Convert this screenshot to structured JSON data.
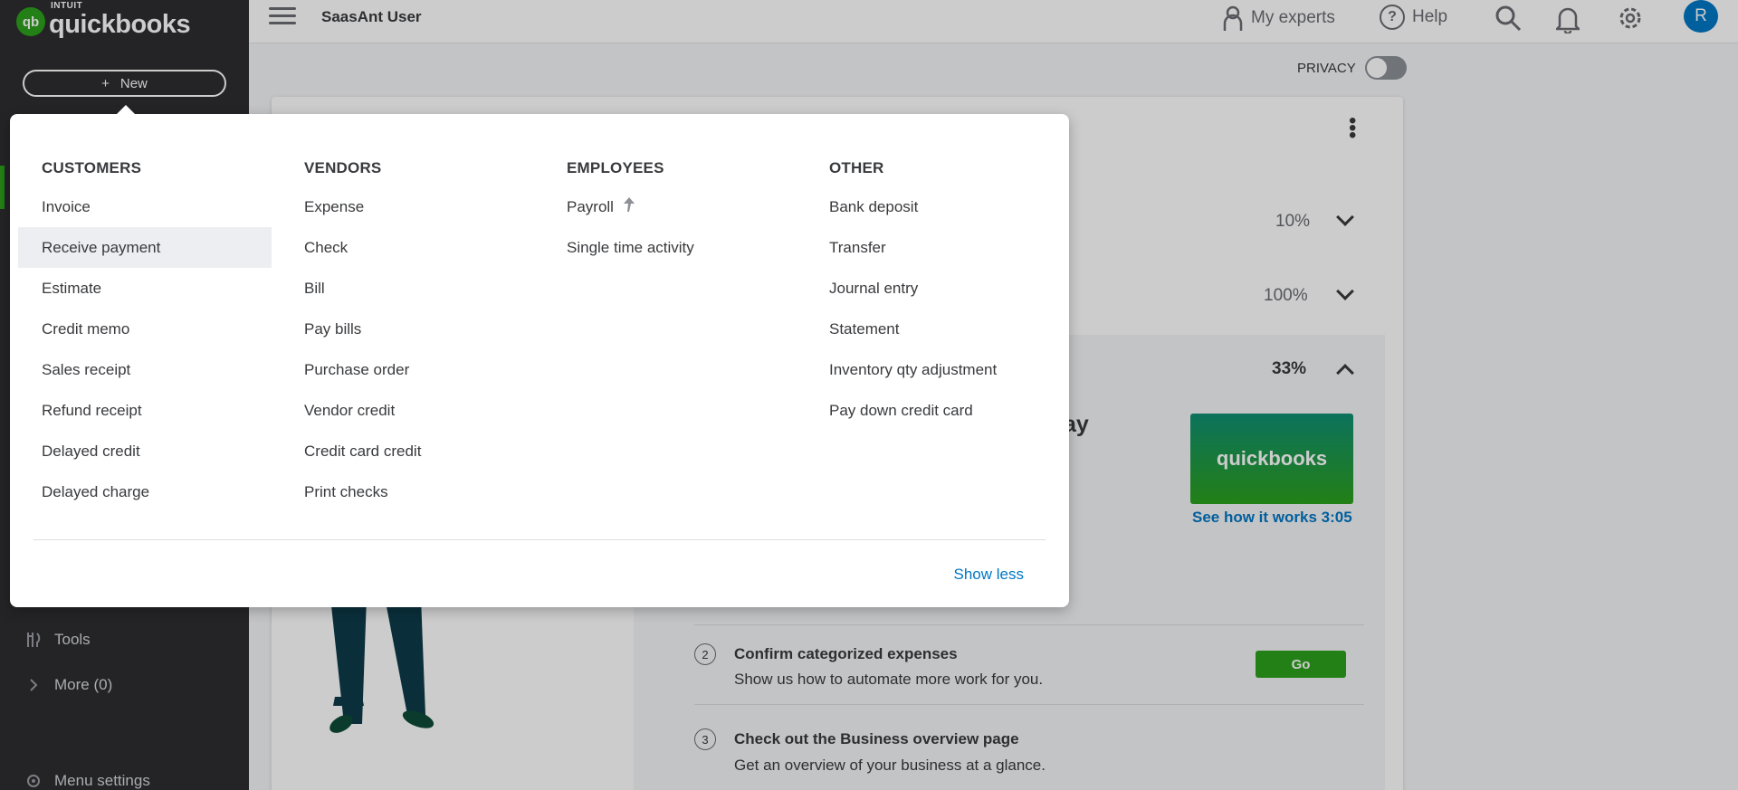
{
  "app": {
    "logo_brand": "INTUIT",
    "logo_word": "quickbooks",
    "company_name": "SaasAnt User"
  },
  "sidebar": {
    "new_button_label": "New",
    "items": [
      {
        "label": "Tools",
        "icon": "tools-icon"
      },
      {
        "label": "More (0)",
        "icon": "chevron-right-icon"
      },
      {
        "label": "Menu settings",
        "icon": "gear-icon"
      }
    ]
  },
  "header": {
    "my_experts": "My experts",
    "help": "Help",
    "avatar_initial": "R"
  },
  "privacy": {
    "label": "PRIVACY",
    "enabled": false
  },
  "setup_card": {
    "progress_rows": [
      "10%",
      "100%",
      "33%"
    ],
    "partial_heading": "ay",
    "video_link": "See how it works 3:05",
    "video_brand": "quickbooks",
    "steps": [
      {
        "number": "2",
        "title": "Confirm categorized expenses",
        "desc": "Show us how to automate more work for you.",
        "button": "Go"
      },
      {
        "number": "3",
        "title": "Check out the Business overview page",
        "desc": "Get an overview of your business at a glance."
      }
    ]
  },
  "new_menu": {
    "columns": [
      {
        "heading": "CUSTOMERS",
        "items": [
          "Invoice",
          "Receive payment",
          "Estimate",
          "Credit memo",
          "Sales receipt",
          "Refund receipt",
          "Delayed credit",
          "Delayed charge"
        ],
        "highlighted": "Receive payment"
      },
      {
        "heading": "VENDORS",
        "items": [
          "Expense",
          "Check",
          "Bill",
          "Pay bills",
          "Purchase order",
          "Vendor credit",
          "Credit card credit",
          "Print checks"
        ]
      },
      {
        "heading": "EMPLOYEES",
        "items": [
          "Payroll",
          "Single time activity"
        ]
      },
      {
        "heading": "OTHER",
        "items": [
          "Bank deposit",
          "Transfer",
          "Journal entry",
          "Statement",
          "Inventory qty adjustment",
          "Pay down credit card"
        ]
      }
    ],
    "show_less": "Show less"
  },
  "colors": {
    "sidebar_bg": "#2d2e30",
    "brand_green": "#2ca01c",
    "link_blue": "#0077c5"
  }
}
